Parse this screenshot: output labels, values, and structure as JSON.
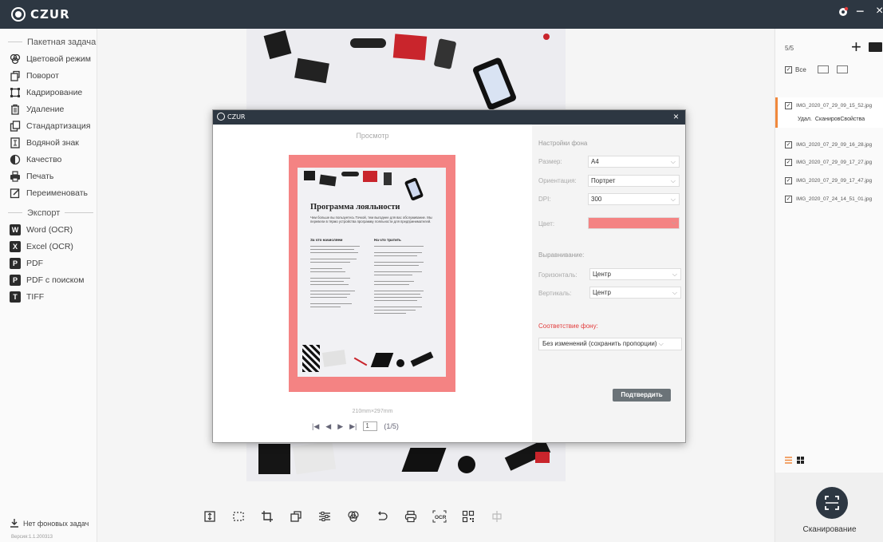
{
  "app": {
    "logo_text": "CZUR"
  },
  "sidebar": {
    "batch_section": "Пакетная задача",
    "items": [
      {
        "label": "Цветовой режим",
        "icon": "color-mode-icon"
      },
      {
        "label": "Поворот",
        "icon": "rotate-icon"
      },
      {
        "label": "Кадрирование",
        "icon": "crop-icon"
      },
      {
        "label": "Удаление",
        "icon": "delete-icon"
      },
      {
        "label": "Стандартизация",
        "icon": "standardize-icon"
      },
      {
        "label": "Водяной знак",
        "icon": "watermark-icon"
      },
      {
        "label": "Качество",
        "icon": "quality-icon"
      },
      {
        "label": "Печать",
        "icon": "print-icon"
      },
      {
        "label": "Переименовать",
        "icon": "rename-icon"
      }
    ],
    "export_section": "Экспорт",
    "export_items": [
      {
        "label": "Word (OCR)",
        "badge": "W"
      },
      {
        "label": "Excel (OCR)",
        "badge": "X"
      },
      {
        "label": "PDF",
        "badge": "P"
      },
      {
        "label": "PDF с поиском",
        "badge": "P"
      },
      {
        "label": "TIFF",
        "badge": "T"
      }
    ],
    "background_tasks": "Нет фоновых задач",
    "version": "Версия:1.1.200313"
  },
  "right_panel": {
    "count": "5/5",
    "select_all": "Все",
    "files": [
      "IMG_2020_07_29_09_15_52.jpg",
      "IMG_2020_07_29_09_16_28.jpg",
      "IMG_2020_07_29_09_17_27.jpg",
      "IMG_2020_07_29_09_17_47.jpg",
      "IMG_2020_07_24_14_51_01.jpg"
    ],
    "file_actions": {
      "delete": "Удал.",
      "scan_props": "СканировСвойства"
    },
    "scan_label": "Сканирование"
  },
  "dialog": {
    "title": "CZUR",
    "preview_label": "Просмотр",
    "doc": {
      "title": "Программа лояльности",
      "paragraph": "Чем больше вы пользуетесь Точкой, тем выгоднее для вас обслуживание. Мы перевели в тёрмо устройства программу лояльности для предпринимателей.",
      "col1_heading": "За что начисляем",
      "col2_heading": "На что тратить"
    },
    "page_size": "210mm×297mm",
    "page_input": "1",
    "page_total": "(1/5)",
    "settings": {
      "background_header": "Настройки фона",
      "size_label": "Размер:",
      "size_value": "A4",
      "orientation_label": "Ориентация:",
      "orientation_value": "Портрет",
      "dpi_label": "DPI:",
      "dpi_value": "300",
      "color_label": "Цвет:",
      "color_value": "#f48383",
      "alignment_header": "Выравнивание:",
      "horizontal_label": "Горизонталь:",
      "horizontal_value": "Центр",
      "vertical_label": "Вертикаль:",
      "vertical_value": "Центр",
      "fit_header": "Соответствие фону:",
      "fit_value": "Без изменений (сохранить пропорции)",
      "confirm_label": "Подтвердить"
    }
  },
  "colors": {
    "titlebar": "#2d3742",
    "accent": "#f0883c",
    "page_background": "#f48383",
    "warning": "#e23c3c"
  }
}
